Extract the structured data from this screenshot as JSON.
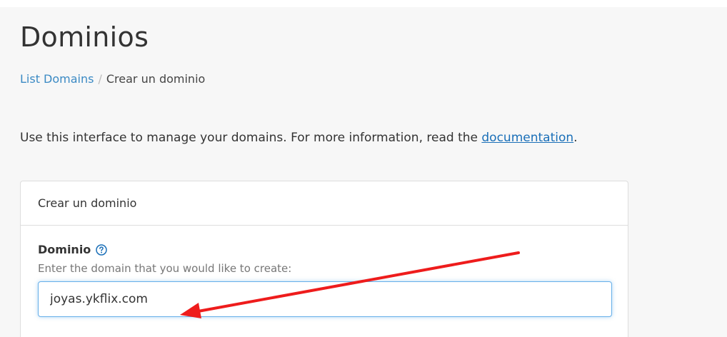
{
  "page": {
    "title": "Dominios"
  },
  "breadcrumb": {
    "link_label": "List Domains",
    "separator": "/",
    "current": "Crear un dominio"
  },
  "intro": {
    "text": "Use this interface to manage your domains. For more information, read the ",
    "link_label": "documentation",
    "suffix": "."
  },
  "panel": {
    "heading": "Crear un dominio",
    "domain_field": {
      "label": "Dominio",
      "help_icon": "question-circle-icon",
      "help_text": "Enter the domain that you would like to create:",
      "value": "joyas.ykflix.com"
    }
  },
  "annotation": {
    "arrow_color": "#ee1c1c"
  },
  "colors": {
    "link": "#3b8ac4",
    "focus_border": "#66afe9",
    "background": "#f7f7f7"
  }
}
